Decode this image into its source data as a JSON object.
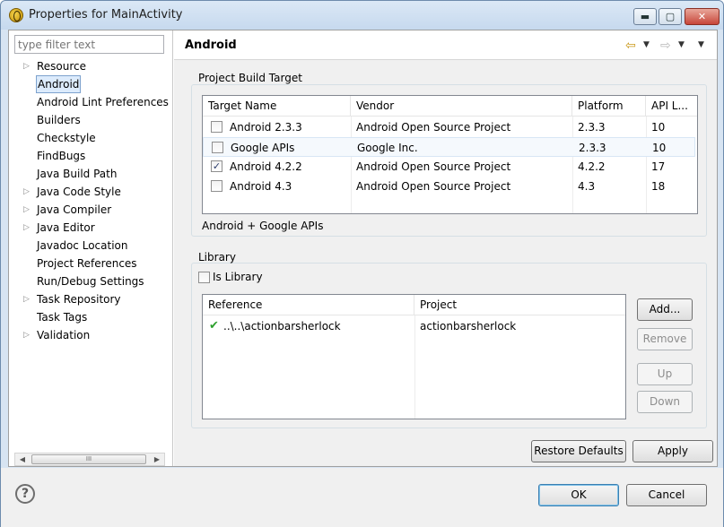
{
  "window": {
    "title": "Properties for MainActivity"
  },
  "filter": {
    "placeholder": "type filter text"
  },
  "tree": [
    {
      "label": "Resource",
      "expandable": true
    },
    {
      "label": "Android",
      "expandable": false,
      "selected": true
    },
    {
      "label": "Android Lint Preferences",
      "expandable": false
    },
    {
      "label": "Builders",
      "expandable": false
    },
    {
      "label": "Checkstyle",
      "expandable": false
    },
    {
      "label": "FindBugs",
      "expandable": false
    },
    {
      "label": "Java Build Path",
      "expandable": false
    },
    {
      "label": "Java Code Style",
      "expandable": true
    },
    {
      "label": "Java Compiler",
      "expandable": true
    },
    {
      "label": "Java Editor",
      "expandable": true
    },
    {
      "label": "Javadoc Location",
      "expandable": false
    },
    {
      "label": "Project References",
      "expandable": false
    },
    {
      "label": "Run/Debug Settings",
      "expandable": false
    },
    {
      "label": "Task Repository",
      "expandable": true
    },
    {
      "label": "Task Tags",
      "expandable": false
    },
    {
      "label": "Validation",
      "expandable": true
    }
  ],
  "page": {
    "title": "Android"
  },
  "build_target": {
    "group_label": "Project Build Target",
    "columns": [
      "Target Name",
      "Vendor",
      "Platform",
      "API L..."
    ],
    "rows": [
      {
        "name": "Android 2.3.3",
        "vendor": "Android Open Source Project",
        "platform": "2.3.3",
        "api": "10",
        "checked": false
      },
      {
        "name": "Google APIs",
        "vendor": "Google Inc.",
        "platform": "2.3.3",
        "api": "10",
        "checked": false
      },
      {
        "name": "Android 4.2.2",
        "vendor": "Android Open Source Project",
        "platform": "4.2.2",
        "api": "17",
        "checked": true
      },
      {
        "name": "Android 4.3",
        "vendor": "Android Open Source Project",
        "platform": "4.3",
        "api": "18",
        "checked": false
      }
    ],
    "description": "Android + Google APIs"
  },
  "library": {
    "group_label": "Library",
    "is_library_label": "Is Library",
    "is_library_checked": false,
    "columns": [
      "Reference",
      "Project"
    ],
    "rows": [
      {
        "reference": "..\\..\\actionbarsherlock",
        "project": "actionbarsherlock"
      }
    ],
    "buttons": {
      "add": "Add...",
      "remove": "Remove",
      "up": "Up",
      "down": "Down"
    }
  },
  "actions": {
    "restore_defaults": "Restore Defaults",
    "apply": "Apply"
  },
  "footer": {
    "ok": "OK",
    "cancel": "Cancel",
    "help_glyph": "?"
  },
  "icons": {
    "check": "✔",
    "checkbox_checked": "✓",
    "scroll_thumb": "III"
  },
  "colors": {
    "accent": "#3c7fb1",
    "check_green": "#2ea02e",
    "nav_arrow": "#c99718"
  }
}
